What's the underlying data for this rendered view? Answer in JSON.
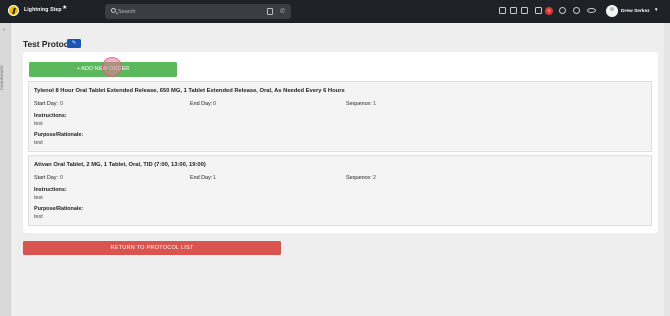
{
  "header": {
    "app_name": "Lightning Step",
    "search_placeholder": "Search",
    "notification_count": "1",
    "user_name": "Drew Serkez",
    "icons": [
      "logo-icon",
      "star-icon",
      "search-icon",
      "calculator-icon",
      "phone-icon",
      "transfer-icon",
      "calendar-icon",
      "grid-icon",
      "chat-icon",
      "bell-icon",
      "help-icon",
      "link-icon",
      "user-avatar",
      "chevron-down-icon"
    ]
  },
  "sidebar": {
    "collapse_glyph": "‹",
    "label": "DASHBOARD"
  },
  "page": {
    "title": "Test Protocol",
    "edit_glyph": "✎"
  },
  "actions": {
    "add_order": "+ ADD NEW ORDER",
    "return": "RETURN TO PROTOCOL LIST"
  },
  "labels": {
    "start_day": "Start Day:",
    "end_day": "End Day:",
    "sequence": "Sequence:",
    "instructions": "Instructions:",
    "purpose": "Purpose/Rationale:"
  },
  "orders": [
    {
      "title": "Tylenol 8 Hour Oral Tablet Extended Release, 650 MG, 1 Tablet Extended Release, Oral, As Needed Every 6 Hours",
      "start_day": "0",
      "end_day": "0",
      "sequence": "1",
      "instructions": "test",
      "purpose": "test"
    },
    {
      "title": "Ativan Oral Tablet, 2 MG, 1 Tablet, Oral, TID (7:00, 13:00, 19:00)",
      "start_day": "0",
      "end_day": "1",
      "sequence": "2",
      "instructions": "test",
      "purpose": "test"
    }
  ],
  "colors": {
    "topbar": "#1f2126",
    "add_button": "#5cb85c",
    "edit_button": "#1a56b4",
    "return_button": "#d9534f",
    "badge": "#d93a35"
  }
}
